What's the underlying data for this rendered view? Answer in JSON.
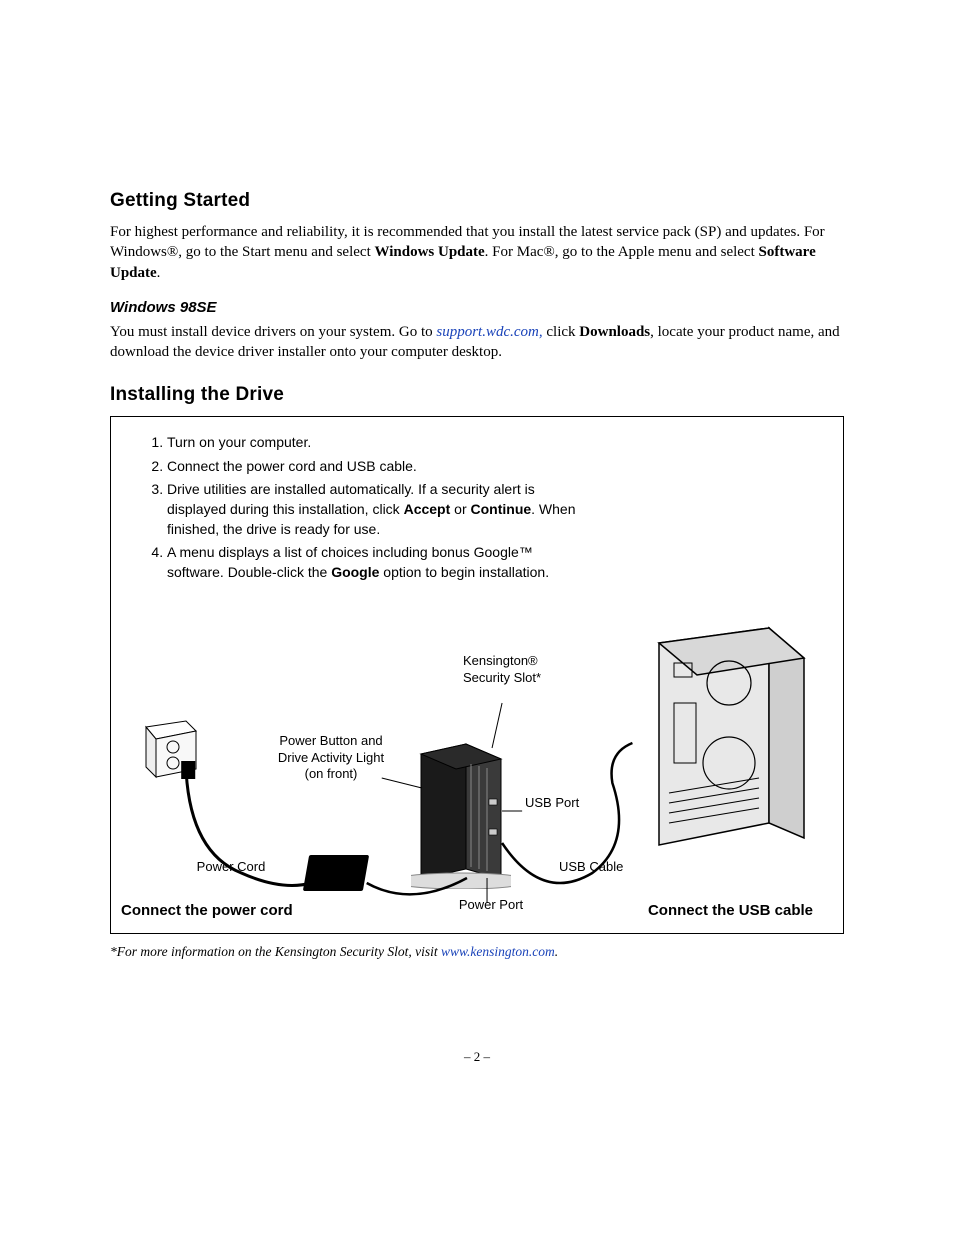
{
  "section1": {
    "title": "Getting Started",
    "para_pre": "For highest performance and reliability, it is recommended that you install the latest service pack (SP) and updates. For Windows®, go to the Start menu and select ",
    "para_b1": "Windows Update",
    "para_mid": ". For Mac®, go to the Apple menu and select ",
    "para_b2": "Software Update",
    "para_end": "."
  },
  "sub": {
    "title": "Windows 98SE",
    "p_pre": "You must install device drivers on your system. Go to ",
    "link": "support.wdc.com,",
    "p_mid": " click ",
    "p_b": "Downloads",
    "p_post": ", locate your product name, and download the device driver installer onto your computer desktop."
  },
  "section2": {
    "title": "Installing the Drive",
    "steps": {
      "s1": "Turn on your computer.",
      "s2": "Connect the power cord and USB cable.",
      "s3_pre": "Drive utilities are installed automatically. If a security alert is displayed during this installation, click ",
      "s3_b1": "Accept",
      "s3_mid": " or ",
      "s3_b2": "Continue",
      "s3_post": ". When finished, the drive is ready for use.",
      "s4_pre": "A menu displays a list of choices including bonus Google™ software. Double-click the ",
      "s4_b": "Google",
      "s4_post": " option to begin installation."
    },
    "labels": {
      "kens": "Kensington® Security Slot*",
      "pwrbtn": "Power Button and Drive Activity Light (on front)",
      "pcord": "Power Cord",
      "usbport": "USB Port",
      "usbcable": "USB Cable",
      "pport": "Power Port",
      "conn_power": "Connect the power cord",
      "conn_usb": "Connect the USB cable"
    }
  },
  "footnote": {
    "pre": "*For more information on the Kensington Security Slot, visit ",
    "link": "www.kensington.com",
    "post": "."
  },
  "pagenum": "– 2 –"
}
